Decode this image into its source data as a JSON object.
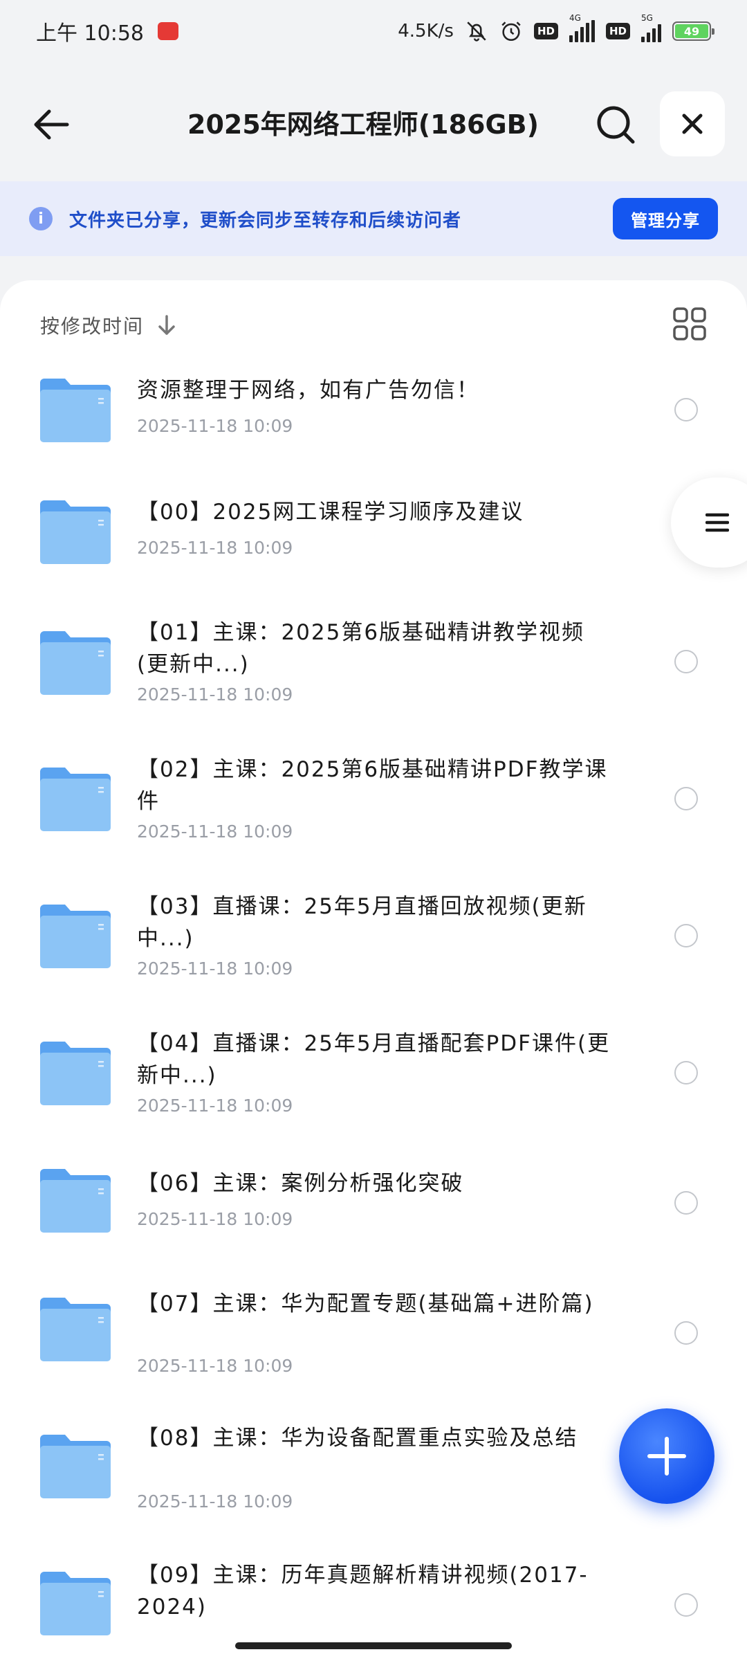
{
  "status_bar": {
    "time": "上午 10:58",
    "app_badge": "头条",
    "net_speed": "4.5K/s",
    "hd1": "HD",
    "sim1_tag": "4G",
    "hd2": "HD",
    "sim2_tag": "5G",
    "battery": "49"
  },
  "header": {
    "title": "2025年网络工程师(186GB)"
  },
  "banner": {
    "info_glyph": "i",
    "text": "文件夹已分享，更新会同步至转存和后续访问者",
    "manage_label": "管理分享"
  },
  "sort": {
    "label": "按修改时间"
  },
  "files": [
    {
      "title": "资源整理于网络，如有广告勿信！",
      "date": "2025-11-18  10:09"
    },
    {
      "title": "【00】2025网工课程学习顺序及建议",
      "date": "2025-11-18  10:09"
    },
    {
      "title": "【01】主课：2025第6版基础精讲教学视频(更新中...)",
      "date": "2025-11-18  10:09"
    },
    {
      "title": "【02】主课：2025第6版基础精讲PDF教学课件",
      "date": "2025-11-18  10:09"
    },
    {
      "title": "【03】直播课：25年5月直播回放视频(更新中...)",
      "date": "2025-11-18  10:09"
    },
    {
      "title": "【04】直播课：25年5月直播配套PDF课件(更新中...)",
      "date": "2025-11-18  10:09"
    },
    {
      "title": "【06】主课：案例分析强化突破",
      "date": "2025-11-18  10:09"
    },
    {
      "title": "【07】主课：华为配置专题(基础篇+进阶篇)",
      "date": "2025-11-18  10:09"
    },
    {
      "title": "【08】主课：华为设备配置重点实验及总结",
      "date": "2025-11-18  10:09"
    },
    {
      "title": "【09】主课：历年真题解析精讲视频(2017-2024)",
      "date": ""
    }
  ],
  "colors": {
    "accent": "#1456f0",
    "banner_bg": "#e8ecfb",
    "banner_text": "#1f4ec9",
    "folder": "#6fb0f3",
    "date_text": "#9a9ea6"
  }
}
